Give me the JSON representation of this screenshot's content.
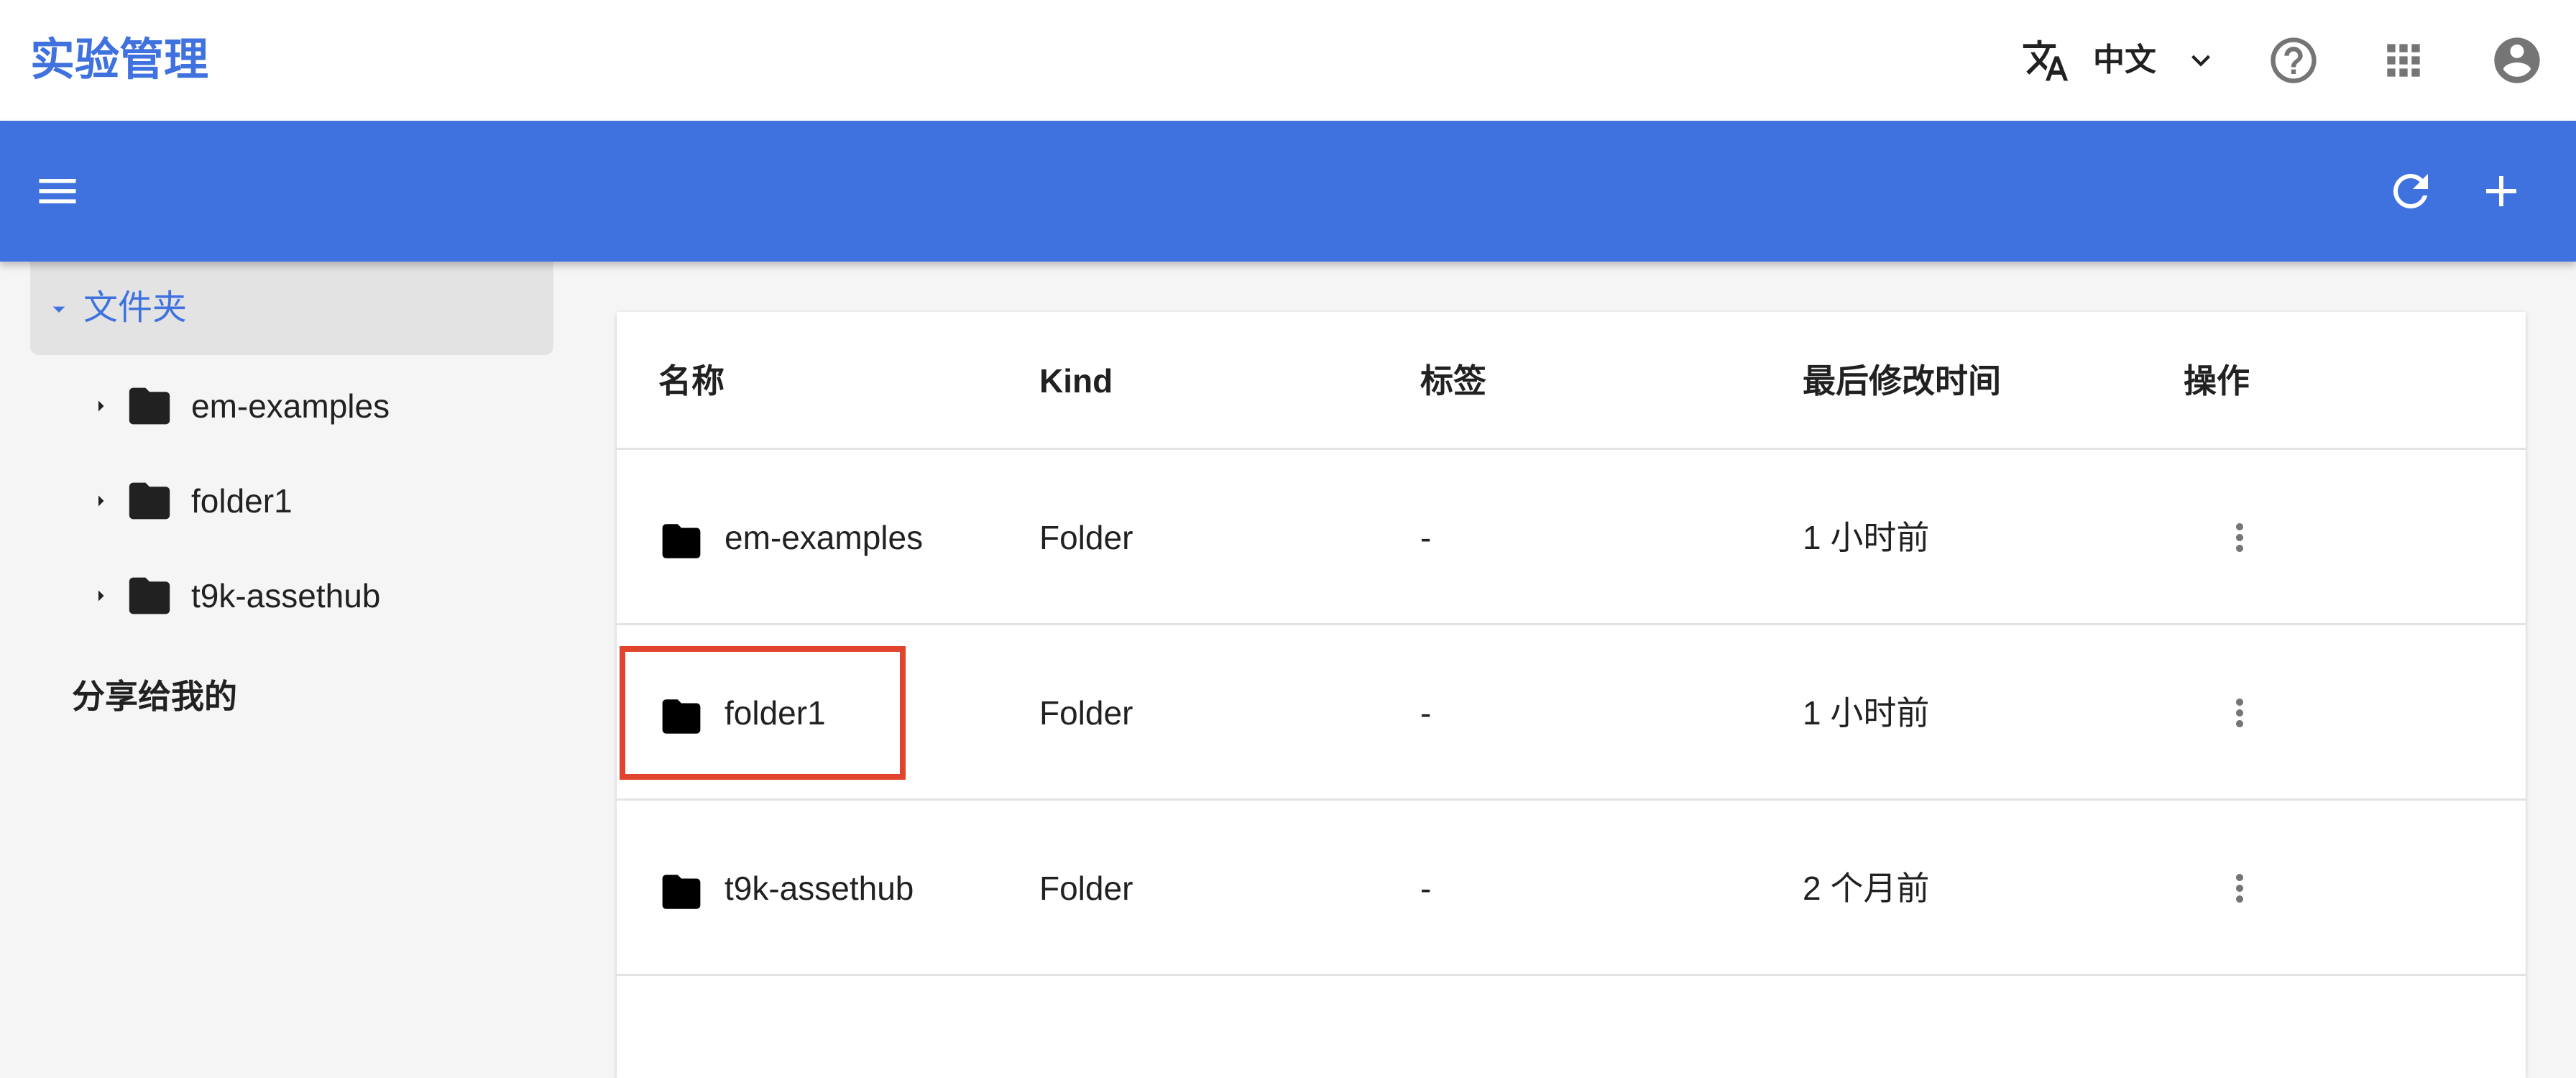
{
  "app": {
    "title": "实验管理"
  },
  "topbar": {
    "language": "中文"
  },
  "icons": {
    "translate": "translate-icon",
    "chevron": "chevron-down-icon",
    "help": "help-circle-icon",
    "apps": "apps-grid-icon",
    "account": "account-circle-icon",
    "menu": "menu-icon",
    "refresh": "refresh-icon",
    "add": "add-icon",
    "folder": "folder-icon",
    "more": "more-vert-icon"
  },
  "colors": {
    "primary": "#3f72df",
    "highlight": "#e0442c"
  },
  "sidebar": {
    "root_label": "文件夹",
    "items": [
      {
        "label": "em-examples"
      },
      {
        "label": "folder1"
      },
      {
        "label": "t9k-assethub"
      }
    ],
    "shared_label": "分享给我的"
  },
  "table": {
    "columns": [
      "名称",
      "Kind",
      "标签",
      "最后修改时间",
      "操作"
    ],
    "rows": [
      {
        "name": "em-examples",
        "kind": "Folder",
        "labels": "-",
        "modified": "1 小时前"
      },
      {
        "name": "folder1",
        "kind": "Folder",
        "labels": "-",
        "modified": "1 小时前"
      },
      {
        "name": "t9k-assethub",
        "kind": "Folder",
        "labels": "-",
        "modified": "2 个月前"
      }
    ]
  }
}
